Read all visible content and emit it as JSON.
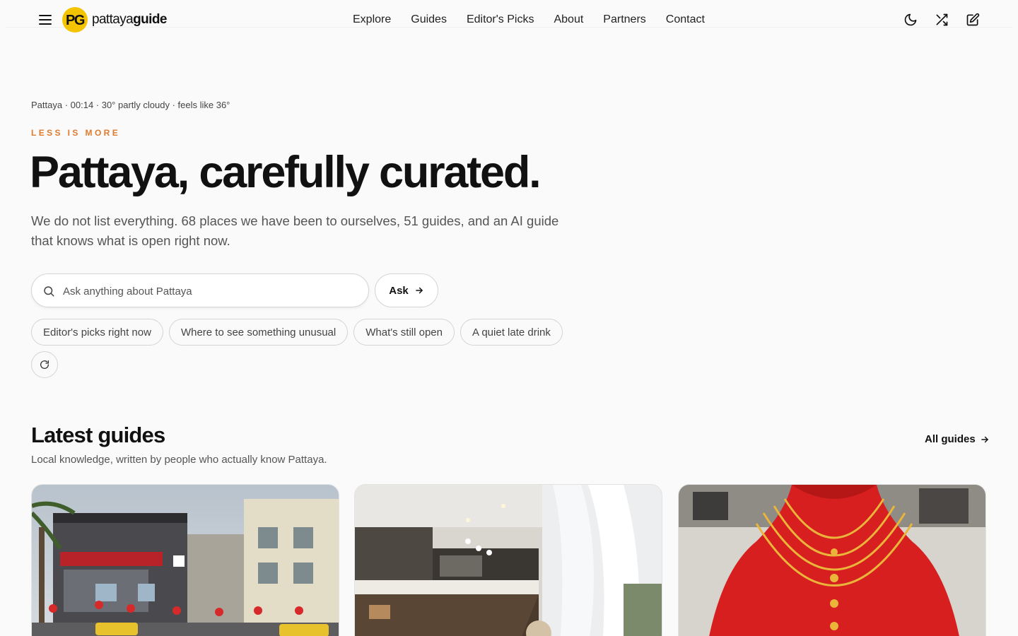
{
  "header": {
    "menu_icon": "hamburger-menu-icon",
    "logo": {
      "mark": "PG",
      "text_light": "pattaya",
      "text_bold": "guide",
      "mark_color": "#f5c400"
    },
    "nav": [
      {
        "label": "Explore"
      },
      {
        "label": "Guides"
      },
      {
        "label": "Editor's Picks"
      },
      {
        "label": "About"
      },
      {
        "label": "Partners"
      },
      {
        "label": "Contact"
      }
    ],
    "icons": [
      "moon-icon",
      "shuffle-icon",
      "edit-icon"
    ]
  },
  "hero": {
    "meta": "Pattaya · 00:14 · 30° partly cloudy · feels like 36°",
    "eyebrow": "LESS IS MORE",
    "title": "Pattaya, carefully curated.",
    "subtitle": "We do not list everything. 68 places we have been to ourselves, 51 guides, and an AI guide that knows what is open right now.",
    "search": {
      "placeholder": "Ask anything about Pattaya",
      "value": ""
    },
    "ask_label": "Ask",
    "suggestions": [
      "Editor's picks right now",
      "Where to see something unusual",
      "What's still open",
      "A quiet late drink"
    ],
    "refresh_icon": "refresh-icon"
  },
  "guides": {
    "title": "Latest guides",
    "subtitle": "Local knowledge, written by people who actually know Pattaya.",
    "all_label": "All guides",
    "cards": [
      {
        "image": "street-scene-image"
      },
      {
        "image": "cafe-interior-image"
      },
      {
        "image": "gold-necklace-image"
      }
    ]
  },
  "colors": {
    "accent": "#e07b2e",
    "background": "#fafafa",
    "border": "#d4d4d4",
    "logo_yellow": "#f5c400"
  }
}
